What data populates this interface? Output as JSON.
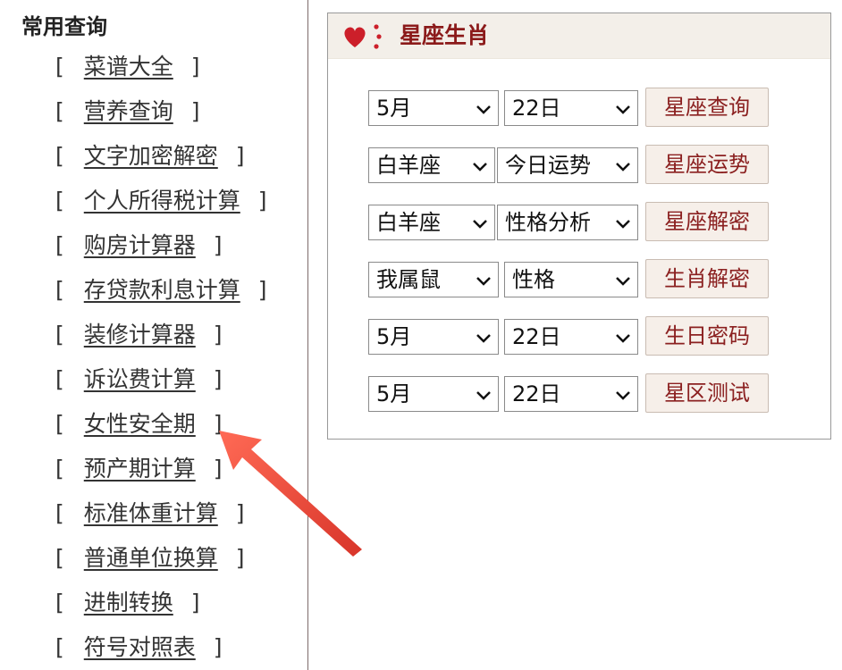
{
  "sidebar": {
    "title": "常用查询",
    "items": [
      {
        "label": "菜谱大全"
      },
      {
        "label": "营养查询"
      },
      {
        "label": "文字加密解密"
      },
      {
        "label": "个人所得税计算"
      },
      {
        "label": "购房计算器"
      },
      {
        "label": "存贷款利息计算"
      },
      {
        "label": "装修计算器"
      },
      {
        "label": "诉讼费计算"
      },
      {
        "label": "女性安全期"
      },
      {
        "label": "预产期计算"
      },
      {
        "label": "标准体重计算"
      },
      {
        "label": "普通单位换算"
      },
      {
        "label": "进制转换"
      },
      {
        "label": "符号对照表"
      }
    ]
  },
  "panel": {
    "title": "星座生肖",
    "rows": [
      {
        "select1": "5月",
        "select2": "22日",
        "button": "星座查询"
      },
      {
        "select1": "白羊座",
        "select2": "今日运势",
        "button": "星座运势"
      },
      {
        "select1": "白羊座",
        "select2": "性格分析",
        "button": "星座解密"
      },
      {
        "select1": "我属鼠",
        "select2": "性格",
        "button": "生肖解密"
      },
      {
        "select1": "5月",
        "select2": "22日",
        "button": "生日密码"
      },
      {
        "select1": "5月",
        "select2": "22日",
        "button": "星区测试"
      }
    ]
  },
  "colors": {
    "accent": "#8b1a1a",
    "arrow": "#e84a3a",
    "header_bg": "#f3efe9"
  },
  "icons": {
    "heart": "heart-icon",
    "dropdown": "chevron-down-icon",
    "annotation": "arrow-icon"
  }
}
